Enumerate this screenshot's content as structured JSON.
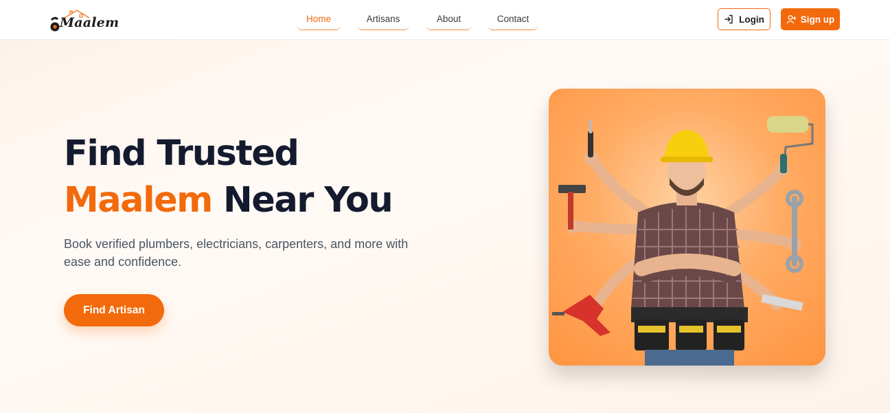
{
  "brand": {
    "name": "Maalem",
    "icon": "house-roof-logo-icon"
  },
  "nav": {
    "links": [
      {
        "label": "Home",
        "active": true
      },
      {
        "label": "Artisans",
        "active": false
      },
      {
        "label": "About",
        "active": false
      },
      {
        "label": "Contact",
        "active": false
      }
    ],
    "login_label": "Login",
    "login_icon": "login-icon",
    "signup_label": "Sign up",
    "signup_icon": "user-plus-icon"
  },
  "hero": {
    "title_line1": "Find Trusted",
    "title_accent": "Maalem",
    "title_line2_rest": " Near You",
    "subtitle": "Book verified plumbers, electricians, carpenters, and more with ease and confidence.",
    "cta_label": "Find Artisan",
    "image": "multi-armed-handyman-with-tools"
  },
  "colors": {
    "accent": "#f26a0c",
    "heading": "#141b2e",
    "body_text": "#4b5563"
  }
}
